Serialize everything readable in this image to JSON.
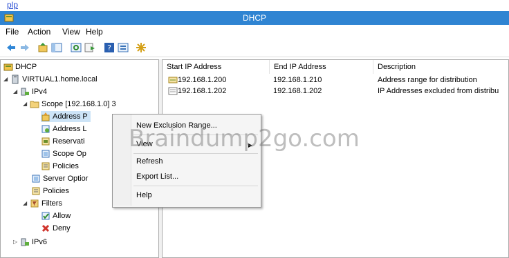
{
  "top_strip": {
    "link_text": "plp",
    "rest_text": ""
  },
  "window": {
    "title": "DHCP"
  },
  "menu": [
    "File",
    "Action",
    "View",
    "Help"
  ],
  "toolbar_icons": [
    "back-icon",
    "forward-icon",
    "up-icon",
    "show-hide-tree-icon",
    "refresh-icon",
    "export-icon",
    "help-icon",
    "properties-icon",
    "new-icon"
  ],
  "tree": {
    "root": "DHCP",
    "server": "VIRTUAL1.home.local",
    "ipv4": "IPv4",
    "scope": "Scope [192.168.1.0] 3",
    "address_pool": "Address P",
    "address_leases": "Address L",
    "reservations": "Reservati",
    "scope_options": "Scope Op",
    "scope_policies": "Policies",
    "server_options": "Server Optior",
    "policies": "Policies",
    "filters": "Filters",
    "allow": "Allow",
    "deny": "Deny",
    "ipv6": "IPv6"
  },
  "list": {
    "columns": [
      "Start IP Address",
      "End IP Address",
      "Description"
    ],
    "rows": [
      {
        "start": "192.168.1.200",
        "end": "192.168.1.210",
        "description": "Address range for distribution"
      },
      {
        "start": "192.168.1.202",
        "end": "192.168.1.202",
        "description": "IP Addresses excluded from distribu"
      }
    ]
  },
  "context_menu": {
    "new_exclusion": "New Exclusion Range...",
    "view": "View",
    "refresh": "Refresh",
    "export": "Export List...",
    "help": "Help"
  },
  "watermark": "Braindump2go.com",
  "colors": {
    "titlebar": "#2f84d2",
    "link": "#2a4fd4"
  }
}
